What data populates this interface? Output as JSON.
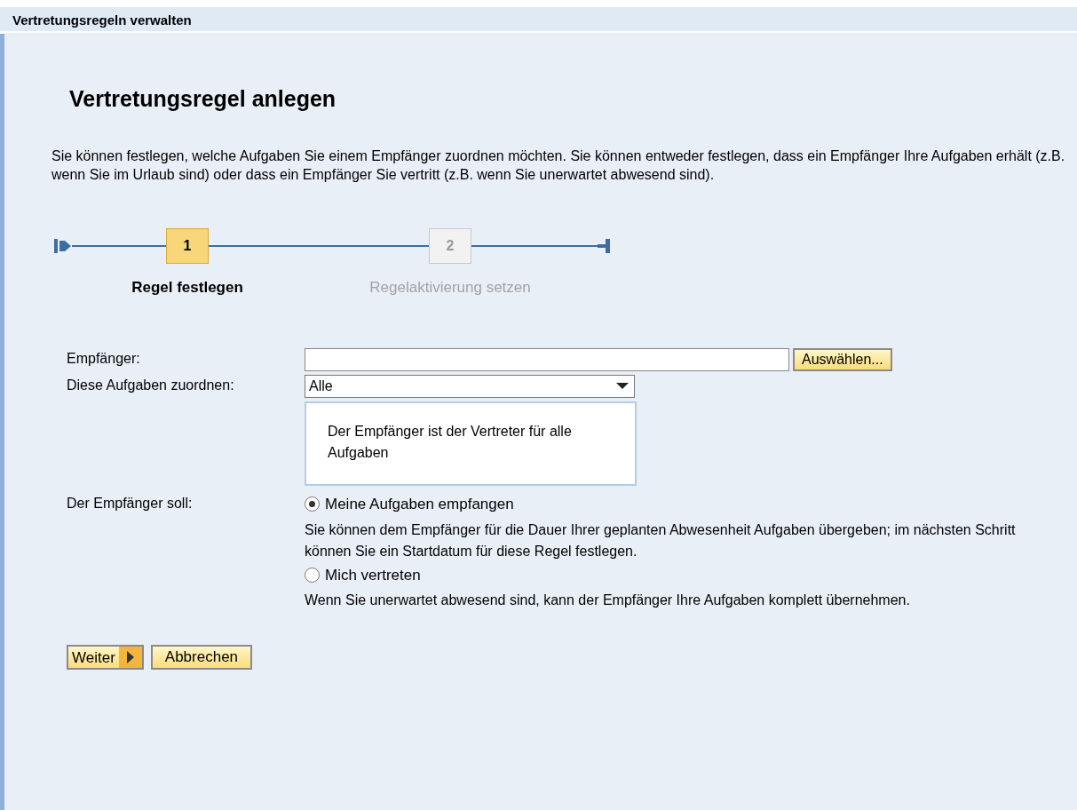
{
  "window": {
    "title": "Vertretungsregeln verwalten"
  },
  "page": {
    "title": "Vertretungsregel anlegen",
    "intro": "Sie können festlegen, welche Aufgaben Sie einem Empfänger zuordnen möchten. Sie können entweder festlegen, dass ein Empfänger Ihre Aufgaben erhält (z.B. wenn Sie im Urlaub sind) oder dass ein Empfänger Sie vertritt (z.B. wenn Sie unerwartet abwesend sind)."
  },
  "steps": [
    {
      "number": "1",
      "label": "Regel festlegen",
      "selected": true
    },
    {
      "number": "2",
      "label": "Regelaktivierung setzen",
      "selected": false
    }
  ],
  "form": {
    "recipient": {
      "label": "Empfänger:",
      "button": "Auswählen..."
    },
    "tasks": {
      "label": "Diese Aufgaben zuordnen:",
      "value": "Alle",
      "description": "Der Empfänger ist der Vertreter für alle Aufgaben"
    },
    "mode": {
      "label": "Der Empfänger soll:",
      "options": [
        {
          "label": "Meine Aufgaben empfangen",
          "selected": true,
          "description": "Sie können dem Empfänger für die Dauer Ihrer geplanten Abwesenheit Aufgaben übergeben; im nächsten Schritt können Sie ein Startdatum für diese Regel festlegen."
        },
        {
          "label": "Mich vertreten",
          "selected": false,
          "description": "Wenn Sie unerwartet abwesend sind, kann der Empfänger Ihre Aufgaben komplett übernehmen."
        }
      ]
    }
  },
  "buttons": [
    {
      "label": "Weiter",
      "kind": "next"
    },
    {
      "label": "Abbrechen",
      "kind": "plain"
    }
  ]
}
